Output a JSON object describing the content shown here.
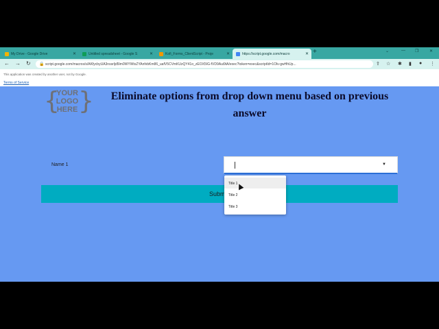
{
  "browser": {
    "tabs": [
      {
        "title": "My Drive - Google Drive",
        "favicon_color": "#f4b400"
      },
      {
        "title": "Untitled spreadsheet - Google S",
        "favicon_color": "#0f9d58"
      },
      {
        "title": "Kofi_Forms_ClientScript - Proje",
        "favicon_color": "#f29900"
      },
      {
        "title": "https://script.google.com/macro",
        "favicon_color": "#4285f4"
      }
    ],
    "url": "script.google.com/macros/s/AKfycbyUA3nssrljd5lm0WYWtxZYAnfvbKm86_uafV5CVmKUzQY41o_zEOX5IG-fVD9Aui9tA/exec?token=exec&scriptId=1Olv-gwHhUp..."
  },
  "banner": {
    "note": "This application was created by another user, not by Google.",
    "terms": "Terms of Service"
  },
  "page": {
    "logo": "YOUR LOGO HERE",
    "title": "Eliminate options from drop down menu based on previous answer",
    "name_label": "Name 1",
    "submit_label": "Submit",
    "dropdown_options": [
      "Title 1",
      "Title 2",
      "Title 3"
    ]
  },
  "colors": {
    "page_background": "#6699f2",
    "submit_background": "#00acc1",
    "tabbar_background": "#38a7a2"
  }
}
